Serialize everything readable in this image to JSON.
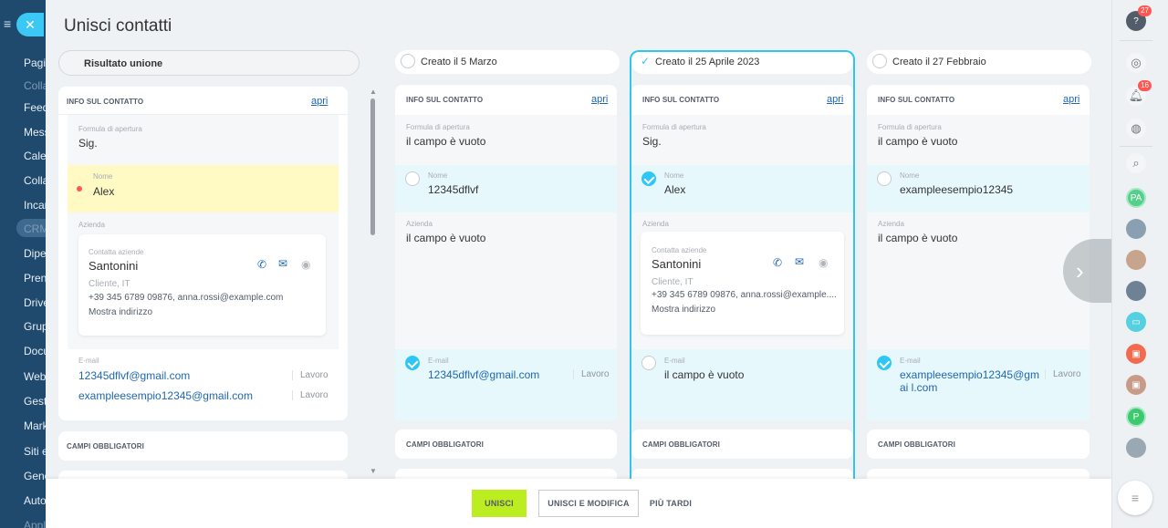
{
  "left_sidebar": {
    "items": [
      "Pagi",
      "Colla",
      "Feed",
      "Mess",
      "Cale",
      "Colla",
      "Incar",
      "CRM",
      "Dipe",
      "Pren",
      "Drive",
      "Grup",
      "Docu",
      "Web",
      "Gest",
      "Mark",
      "Siti e",
      "Gene",
      "Auto",
      "Appl"
    ]
  },
  "slider": {
    "title": "Unisci contatti",
    "result_label": "Risultato unione"
  },
  "section": {
    "info_title": "INFO SUL CONTATTO",
    "open_link": "apri",
    "mandatory_title": "CAMPI OBBLIGATORI"
  },
  "labels": {
    "salutation": "Formula di apertura",
    "name": "Nome",
    "company": "Azienda",
    "company_contact": "Contatta aziende",
    "email": "E-mail",
    "work": "Lavoro",
    "empty": "il campo è vuoto"
  },
  "result": {
    "salutation": "Sig.",
    "name": "Alex",
    "company_name": "Santonini",
    "company_type": "Cliente, IT",
    "company_contacts": "+39 345 6789 09876, anna.rossi@example.com",
    "company_address": "Mostra indirizzo",
    "emails": [
      "12345dflvf@gmail.com",
      "exampleesempio12345@gmail.com"
    ]
  },
  "columns": [
    {
      "header": "Creato il 5 Marzo",
      "selected": false,
      "salutation": "il campo è vuoto",
      "name": "12345dflvf",
      "company": "il campo è vuoto",
      "email": "12345dflvf@gmail.com"
    },
    {
      "header": "Creato il 25 Aprile 2023",
      "selected": true,
      "salutation": "Sig.",
      "name": "Alex",
      "company_name": "Santonini",
      "company_type": "Cliente, IT",
      "company_contacts": "+39 345 6789 09876, anna.rossi@example....",
      "company_address": "Mostra indirizzo",
      "email": "il campo è vuoto"
    },
    {
      "header": "Creato il 27 Febbraio",
      "selected": false,
      "salutation": "il campo è vuoto",
      "name": "exampleesempio12345",
      "company": "il campo è vuoto",
      "email": "exampleesempio12345@gmai l.com"
    }
  ],
  "footer": {
    "merge": "UNISCI",
    "merge_edit": "UNISCI E MODIFICA",
    "later": "PIÙ TARDI"
  },
  "right_sidebar": {
    "help_badge": "27",
    "notif_badge": "16",
    "avatar_pa": "PA",
    "avatar_p": "P"
  },
  "colors": {
    "accent": "#2fc6f6",
    "primary_button": "#bbed21",
    "highlight_yellow": "#fff9c4",
    "highlight_blue": "#e7f8fc"
  }
}
